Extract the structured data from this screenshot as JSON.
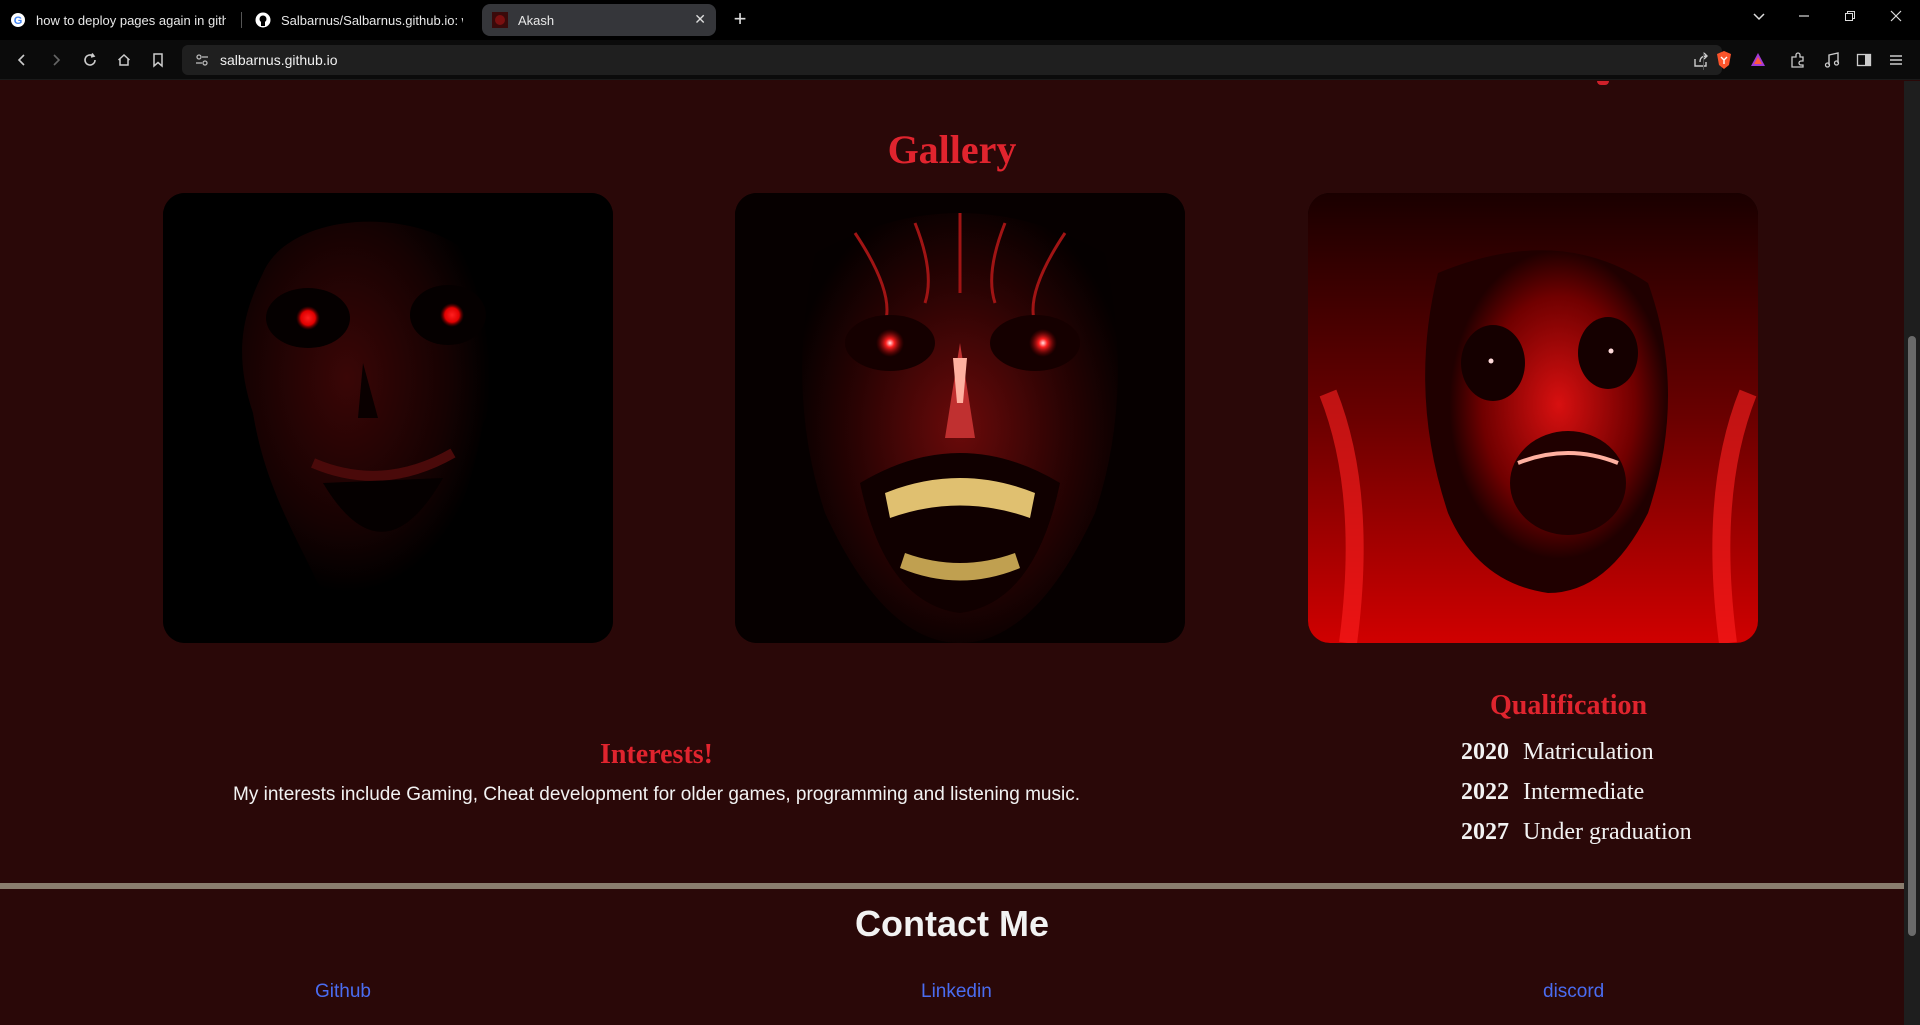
{
  "browser": {
    "tabs": [
      {
        "title": "how to deploy pages again in github",
        "icon": "google-icon"
      },
      {
        "title": "Salbarnus/Salbarnus.github.io: webs",
        "icon": "github-icon"
      },
      {
        "title": "Akash",
        "icon": "site-favicon",
        "active": true
      }
    ],
    "url": "salbarnus.github.io"
  },
  "gallery": {
    "title": "Gallery",
    "images": [
      {
        "alt": "dark skull with glowing red eyes"
      },
      {
        "alt": "red veined demon face with grin"
      },
      {
        "alt": "screaming red ghoul face"
      }
    ]
  },
  "interests": {
    "title": "Interests!",
    "text": "My interests include Gaming, Cheat development for older games, programming and listening music."
  },
  "qualification": {
    "title": "Qualification",
    "items": [
      {
        "year": "2020",
        "label": "Matriculation"
      },
      {
        "year": "2022",
        "label": "Intermediate"
      },
      {
        "year": "2027",
        "label": "Under graduation"
      }
    ]
  },
  "contact": {
    "title": "Contact Me",
    "links": [
      "Github",
      "Linkedin",
      "discord"
    ]
  },
  "colors": {
    "page_bg": "#2a0808",
    "heading_red": "#e0242e",
    "link_blue": "#4a6cf0"
  }
}
